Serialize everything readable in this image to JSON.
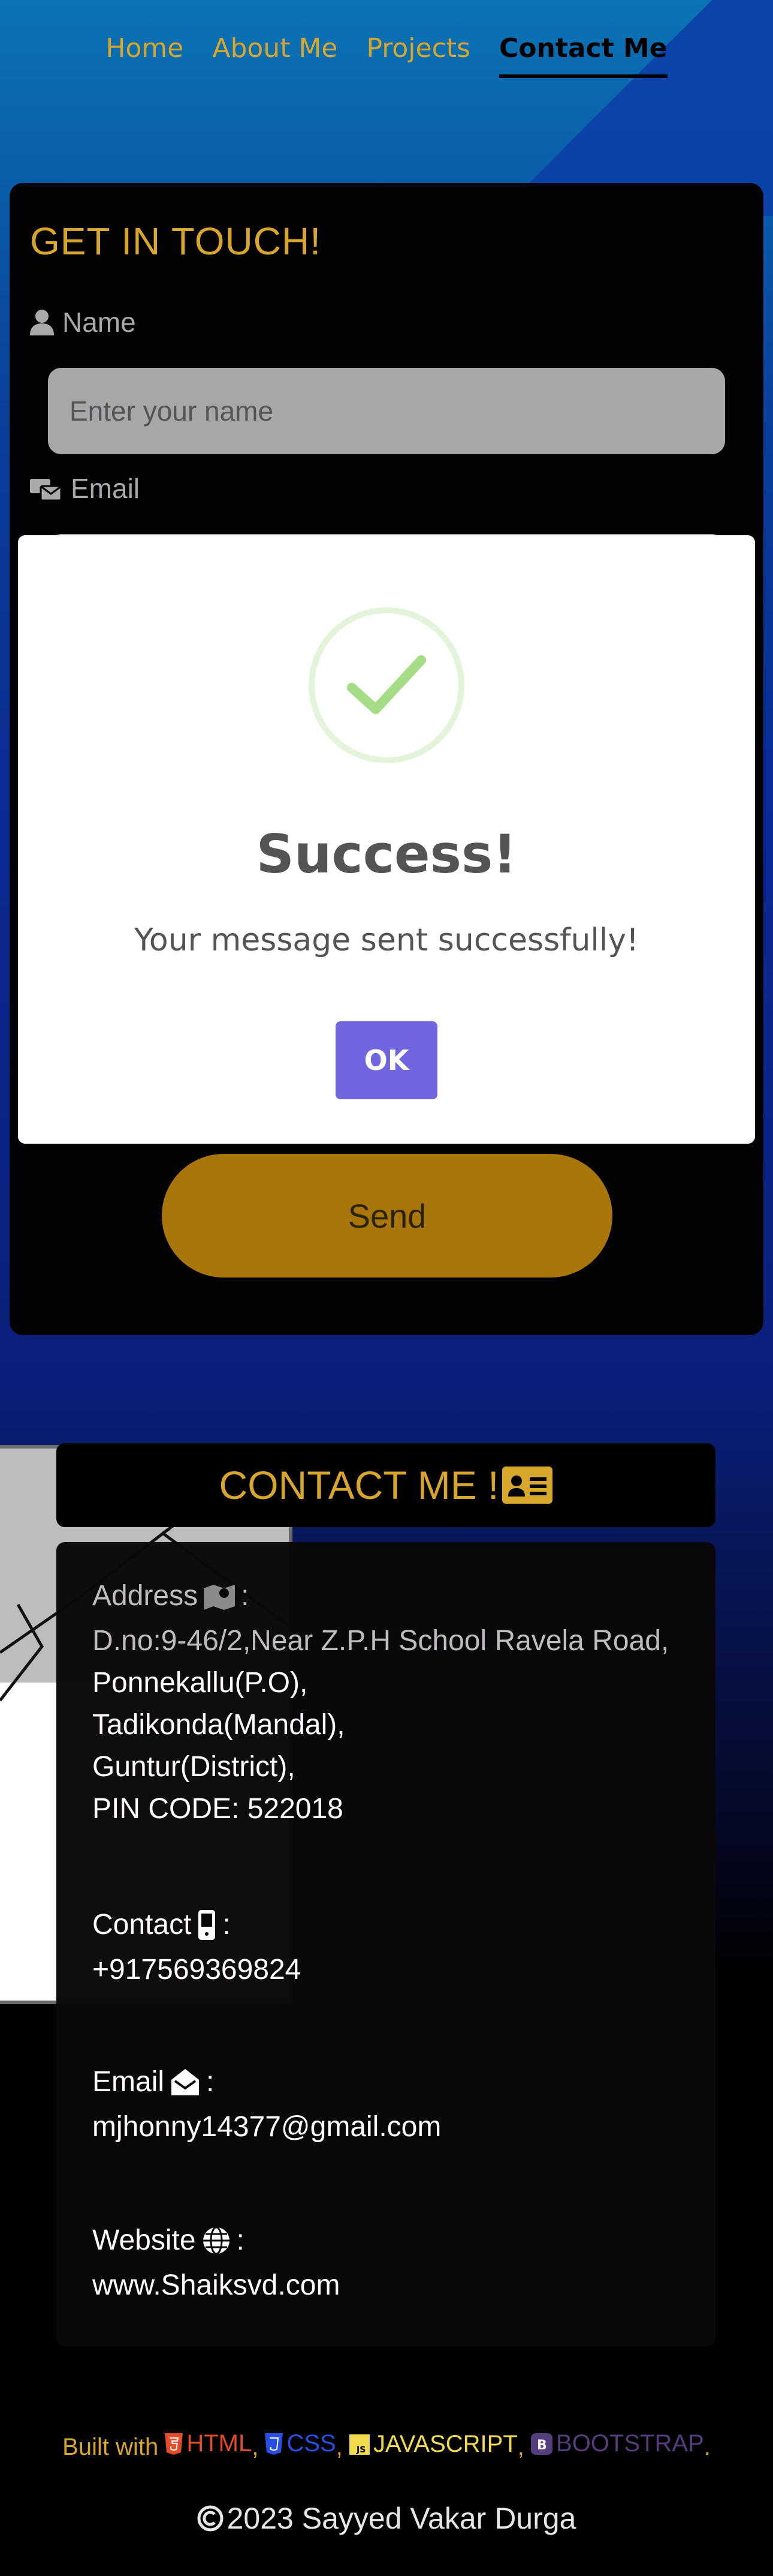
{
  "nav": {
    "items": [
      {
        "label": "Home",
        "active": false
      },
      {
        "label": "About Me",
        "active": false
      },
      {
        "label": "Projects",
        "active": false
      },
      {
        "label": "Contact Me",
        "active": true
      }
    ]
  },
  "form": {
    "title": "GET IN TOUCH!",
    "name_label": "Name",
    "name_placeholder": "Enter your name",
    "email_label": "Email",
    "send_label": "Send"
  },
  "modal": {
    "title": "Success!",
    "text": "Your message sent successfully!",
    "ok_label": "OK"
  },
  "contact": {
    "title": "CONTACT ME !",
    "address_label": "Address",
    "address_lines": [
      "D.no:9-46/2,Near Z.P.H School Ravela Road,",
      "Ponnekallu(P.O),",
      "Tadikonda(Mandal),",
      "Guntur(District),",
      "PIN CODE: 522018"
    ],
    "phone_label": "Contact",
    "phone": "+917569369824",
    "email_label": "Email",
    "email": "mjhonny14377@gmail.com",
    "website_label": "Website",
    "website": "www.Shaiksvd.com",
    "colon": ":"
  },
  "footer": {
    "built_with": "Built with",
    "html": "HTML",
    "css": "CSS",
    "js": "JAVASCRIPT",
    "bootstrap": "BOOTSTRAP",
    "sep": ",",
    "end": ".",
    "copyright": "2023 Sayyed Vakar Durga"
  },
  "colors": {
    "accent": "#d9a62c",
    "send_button": "#a8760a",
    "ok_button": "#7066e0",
    "success_green": "#a5dc86"
  }
}
